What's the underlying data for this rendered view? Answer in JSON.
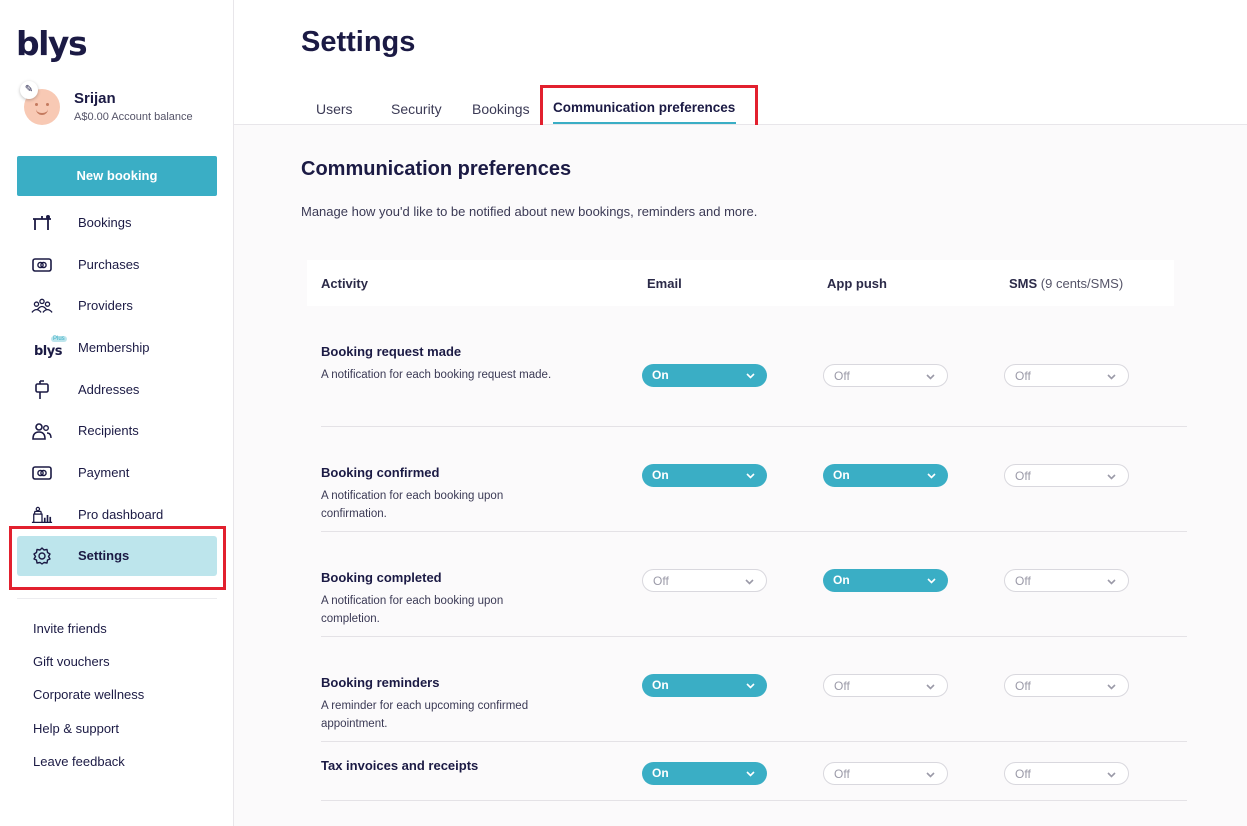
{
  "brand": {
    "logo": "blys",
    "accent": "#3aaec5"
  },
  "profile": {
    "name": "Srijan",
    "balance": "A$0.00 Account balance"
  },
  "sidebar": {
    "new_booking": "New booking",
    "items": [
      {
        "label": "Bookings",
        "icon": "massage-table-icon"
      },
      {
        "label": "Purchases",
        "icon": "cash-icon"
      },
      {
        "label": "Providers",
        "icon": "group-icon"
      },
      {
        "label": "Membership",
        "icon": "blys-plus-icon",
        "badge_logo": "blys",
        "badge_plus": "Plus"
      },
      {
        "label": "Addresses",
        "icon": "mailbox-icon"
      },
      {
        "label": "Recipients",
        "icon": "users-icon"
      },
      {
        "label": "Payment",
        "icon": "cash-icon"
      },
      {
        "label": "Pro dashboard",
        "icon": "pro-dashboard-icon"
      },
      {
        "label": "Settings",
        "icon": "gear-icon",
        "active": true
      }
    ],
    "links": [
      "Invite friends",
      "Gift vouchers",
      "Corporate wellness",
      "Help & support",
      "Leave feedback"
    ]
  },
  "page": {
    "title": "Settings",
    "tabs": [
      {
        "label": "Users"
      },
      {
        "label": "Security"
      },
      {
        "label": "Bookings"
      },
      {
        "label": "Communication preferences",
        "active": true
      }
    ]
  },
  "prefs": {
    "title": "Communication preferences",
    "description": "Manage how you'd like to be notified about new bookings, reminders and more.",
    "columns": {
      "activity": "Activity",
      "email": "Email",
      "app_push": "App push",
      "sms": "SMS",
      "sms_note": "(9 cents/SMS)"
    },
    "rows": [
      {
        "title": "Booking request made",
        "desc": "A notification for each booking request made.",
        "email": "On",
        "push": "Off",
        "sms": "Off"
      },
      {
        "title": "Booking confirmed",
        "desc": "A notification for each booking upon confirmation.",
        "email": "On",
        "push": "On",
        "sms": "Off"
      },
      {
        "title": "Booking completed",
        "desc": "A notification for each booking upon completion.",
        "email": "Off",
        "push": "On",
        "sms": "Off"
      },
      {
        "title": "Booking reminders",
        "desc": "A reminder for each upcoming confirmed appointment.",
        "email": "On",
        "push": "Off",
        "sms": "Off"
      },
      {
        "title": "Tax invoices and receipts",
        "desc": "",
        "email": "On",
        "push": "Off",
        "sms": "Off"
      }
    ]
  }
}
